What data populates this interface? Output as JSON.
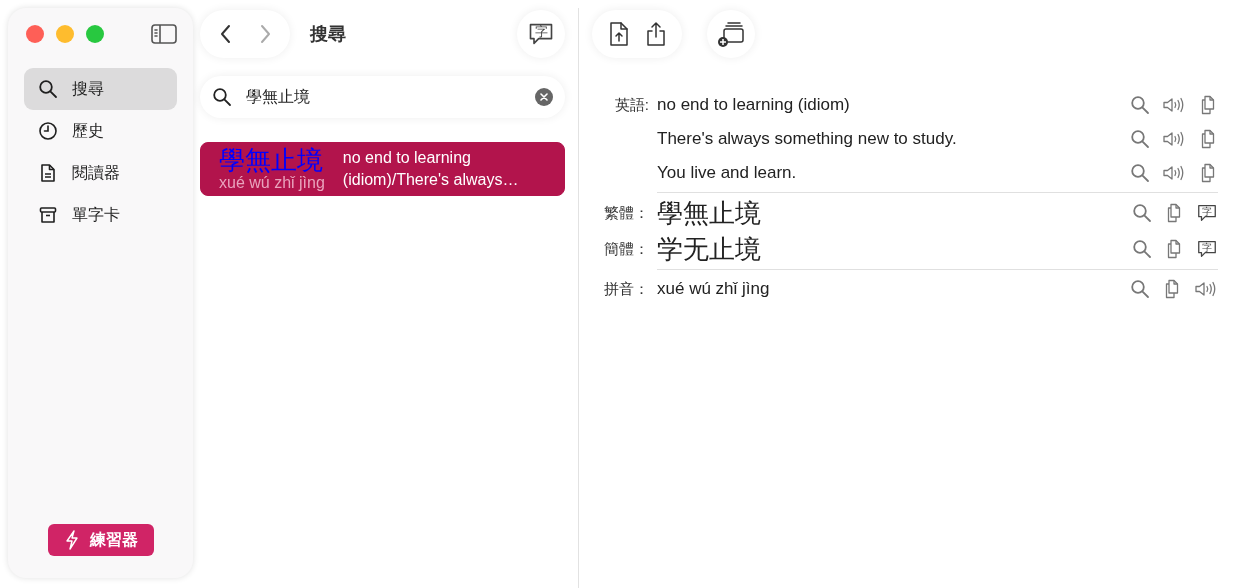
{
  "sidebar": {
    "items": [
      {
        "label": "搜尋",
        "kind": "search",
        "selected": true
      },
      {
        "label": "歷史",
        "kind": "clock",
        "selected": false
      },
      {
        "label": "閱讀器",
        "kind": "document",
        "selected": false
      },
      {
        "label": "單字卡",
        "kind": "archive",
        "selected": false
      }
    ],
    "practice_button": {
      "label": "練習器"
    }
  },
  "search_column": {
    "title": "搜尋",
    "chars_button": {
      "glyph": "字"
    },
    "search": {
      "value": "學無止境"
    },
    "results": [
      {
        "hanzi": "學無止境",
        "pinyin": "xué wú zhǐ jìng",
        "definition": "no end to learning (idiom)/There's always…",
        "selected": true
      }
    ]
  },
  "detail": {
    "groups": [
      {
        "rows": [
          {
            "label": "英語:",
            "kind": "text",
            "text": "no end to learning (idiom)",
            "actions": [
              {
                "kind": "search"
              },
              {
                "kind": "speaker"
              },
              {
                "kind": "copy"
              }
            ]
          },
          {
            "kind": "text",
            "text": "There's always something new to study.",
            "actions": [
              {
                "kind": "search"
              },
              {
                "kind": "speaker"
              },
              {
                "kind": "copy"
              }
            ]
          },
          {
            "kind": "text",
            "text": "You live and learn.",
            "actions": [
              {
                "kind": "search"
              },
              {
                "kind": "speaker"
              },
              {
                "kind": "copy"
              }
            ]
          }
        ]
      },
      {
        "rows": [
          {
            "label": "繁體：",
            "kind": "hanzi",
            "text": "學無止境",
            "actions": [
              {
                "kind": "search"
              },
              {
                "kind": "copy"
              },
              {
                "kind": "char",
                "glyph": "字"
              }
            ]
          },
          {
            "label": "簡體：",
            "kind": "hanzi",
            "text": "学无止境",
            "actions": [
              {
                "kind": "search"
              },
              {
                "kind": "copy"
              },
              {
                "kind": "char",
                "glyph": "字"
              }
            ]
          }
        ]
      },
      {
        "rows": [
          {
            "label": "拼音：",
            "kind": "text",
            "text": "xué wú zhǐ jìng",
            "actions": [
              {
                "kind": "search"
              },
              {
                "kind": "copy"
              },
              {
                "kind": "speaker"
              }
            ]
          }
        ]
      }
    ]
  }
}
